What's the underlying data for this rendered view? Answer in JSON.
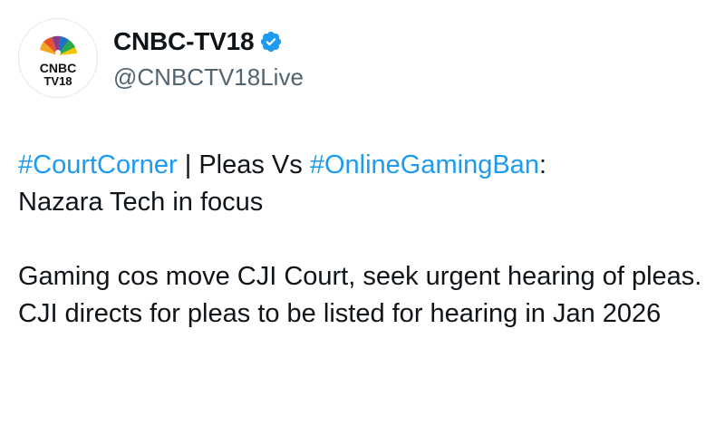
{
  "author": {
    "display_name": "CNBC-TV18",
    "handle": "@CNBCTV18Live",
    "avatar_text_top": "CNBC",
    "avatar_text_bottom": "TV18",
    "verified_icon": "verified-badge-icon"
  },
  "tweet": {
    "hashtag_1": "#CourtCorner",
    "sep_1": " | Pleas Vs ",
    "hashtag_2": "#OnlineGamingBan",
    "tail_1": ":",
    "line_2": "Nazara Tech in focus",
    "paragraph_2": "Gaming cos move CJI Court, seek urgent hearing of pleas. CJI directs for pleas to be listed for hearing in Jan 2026"
  },
  "colors": {
    "hashtag": "#1d9bf0",
    "handle": "#536471",
    "verified": "#1d9bf0",
    "text": "#0f1419"
  }
}
